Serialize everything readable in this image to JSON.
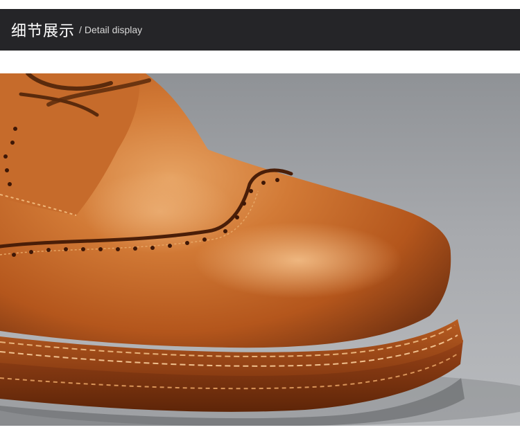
{
  "header": {
    "title_cn": "细节展示",
    "separator": "/",
    "title_en": "Detail display"
  },
  "colors": {
    "header_bg": "#252528",
    "leather_main": "#c8692a",
    "leather_highlight": "#e39a5c",
    "leather_dark": "#7a3a12",
    "background_gray": "#9a9ca0"
  },
  "photo": {
    "subject": "shoe-photo"
  }
}
